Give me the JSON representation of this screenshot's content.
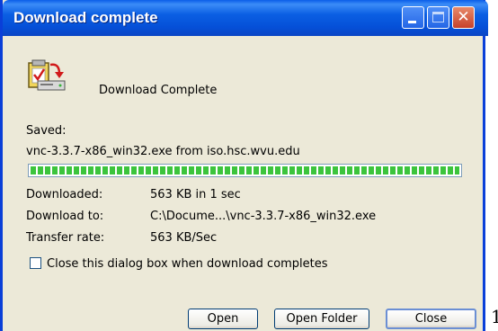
{
  "window": {
    "title": "Download complete",
    "close_glyph": "✕"
  },
  "icons": {
    "app": "download-clipboard-icon",
    "minimize": "minimize-icon",
    "maximize": "maximize-icon",
    "close": "close-icon"
  },
  "status": "Download Complete",
  "saved": {
    "label": "Saved:",
    "file": "vnc-3.3.7-x86_win32.exe from iso.hsc.wvu.edu"
  },
  "progress": {
    "fraction": 1.0
  },
  "details": [
    {
      "label": "Downloaded:",
      "value": "563 KB in 1 sec"
    },
    {
      "label": "Download to:",
      "value": "C:\\Docume...\\vnc-3.3.7-x86_win32.exe"
    },
    {
      "label": "Transfer rate:",
      "value": "563 KB/Sec"
    }
  ],
  "close_on_complete": {
    "label": "Close this dialog box when download completes",
    "checked": false
  },
  "buttons": {
    "open": "Open",
    "open_folder": "Open Folder",
    "close": "Close"
  },
  "stray_text": "1"
}
